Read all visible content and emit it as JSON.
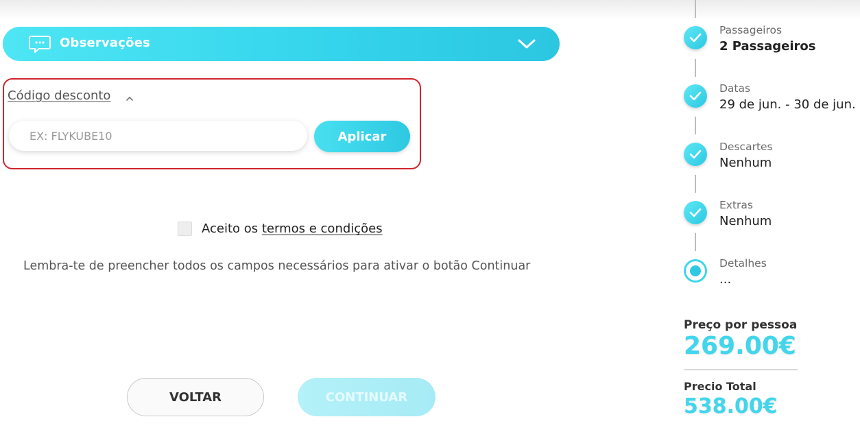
{
  "observations": {
    "label": "Observações"
  },
  "discount": {
    "title": "Código desconto",
    "placeholder": "EX: FLYKUBE10",
    "apply_label": "Aplicar"
  },
  "terms": {
    "prefix": "Aceito os ",
    "link": "termos e condições",
    "checked": false
  },
  "reminder": "Lembra-te de preencher todos os campos necessários para ativar o botão Continuar",
  "buttons": {
    "back": "VOLTAR",
    "continue": "CONTINUAR"
  },
  "steps": [
    {
      "label": "Passageiros",
      "value": "2 Passageiros",
      "status": "done"
    },
    {
      "label": "Datas",
      "value": "29 de jun. - 30 de jun.",
      "status": "done"
    },
    {
      "label": "Descartes",
      "value": "Nenhum",
      "status": "done"
    },
    {
      "label": "Extras",
      "value": "Nenhum",
      "status": "done"
    },
    {
      "label": "Detalhes",
      "value": "...",
      "status": "current"
    }
  ],
  "pricing": {
    "per_person_label": "Preço por pessoa",
    "per_person_value": "269.00€",
    "total_label": "Precio Total",
    "total_value": "538.00€"
  },
  "colors": {
    "accent": "#36d2ea",
    "highlight_border": "#d0242e"
  }
}
